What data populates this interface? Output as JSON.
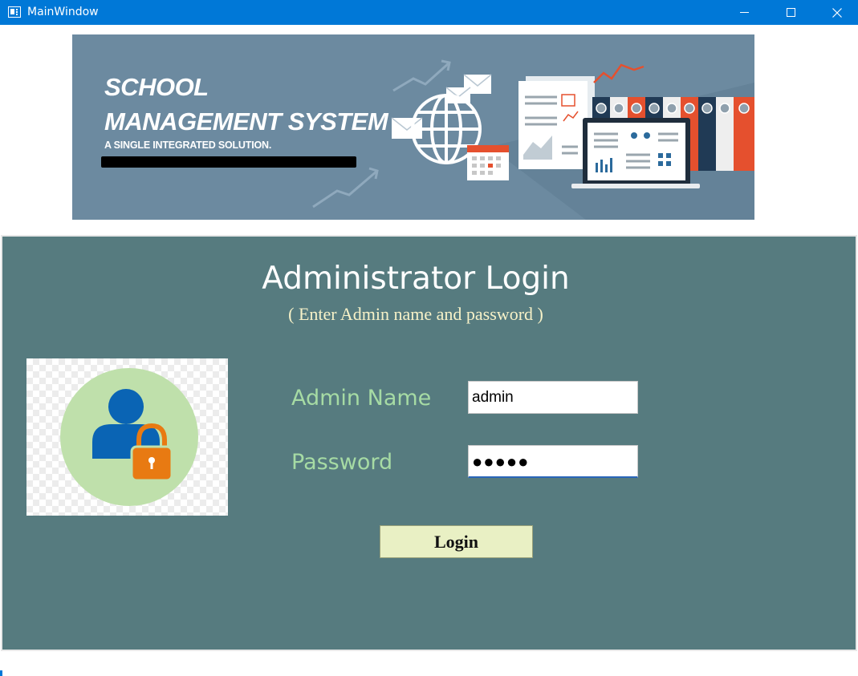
{
  "window": {
    "title": "MainWindow",
    "accent_color": "#0078d7",
    "controls": {
      "minimize_icon": "minimize-icon",
      "maximize_icon": "maximize-icon",
      "close_icon": "close-icon"
    }
  },
  "banner": {
    "title_line1": "SCHOOL",
    "title_line2": "MANAGEMENT SYSTEM",
    "tagline": "A SINGLE INTEGRATED SOLUTION.",
    "background_color": "#6c8aa0",
    "illustration_icons": [
      "globe-icon",
      "envelope-icon",
      "calendar-icon",
      "document-icon",
      "laptop-icon",
      "binders-icon",
      "trend-arrow-icon"
    ]
  },
  "login": {
    "heading": "Administrator Login",
    "subheading": "( Enter Admin name and password )",
    "panel_color": "#567b7f",
    "avatar_icon": "admin-lock-icon",
    "admin_name_label": "Admin Name",
    "admin_name_value": "admin",
    "password_label": "Password",
    "password_value": "●●●●●",
    "login_button_label": "Login"
  }
}
